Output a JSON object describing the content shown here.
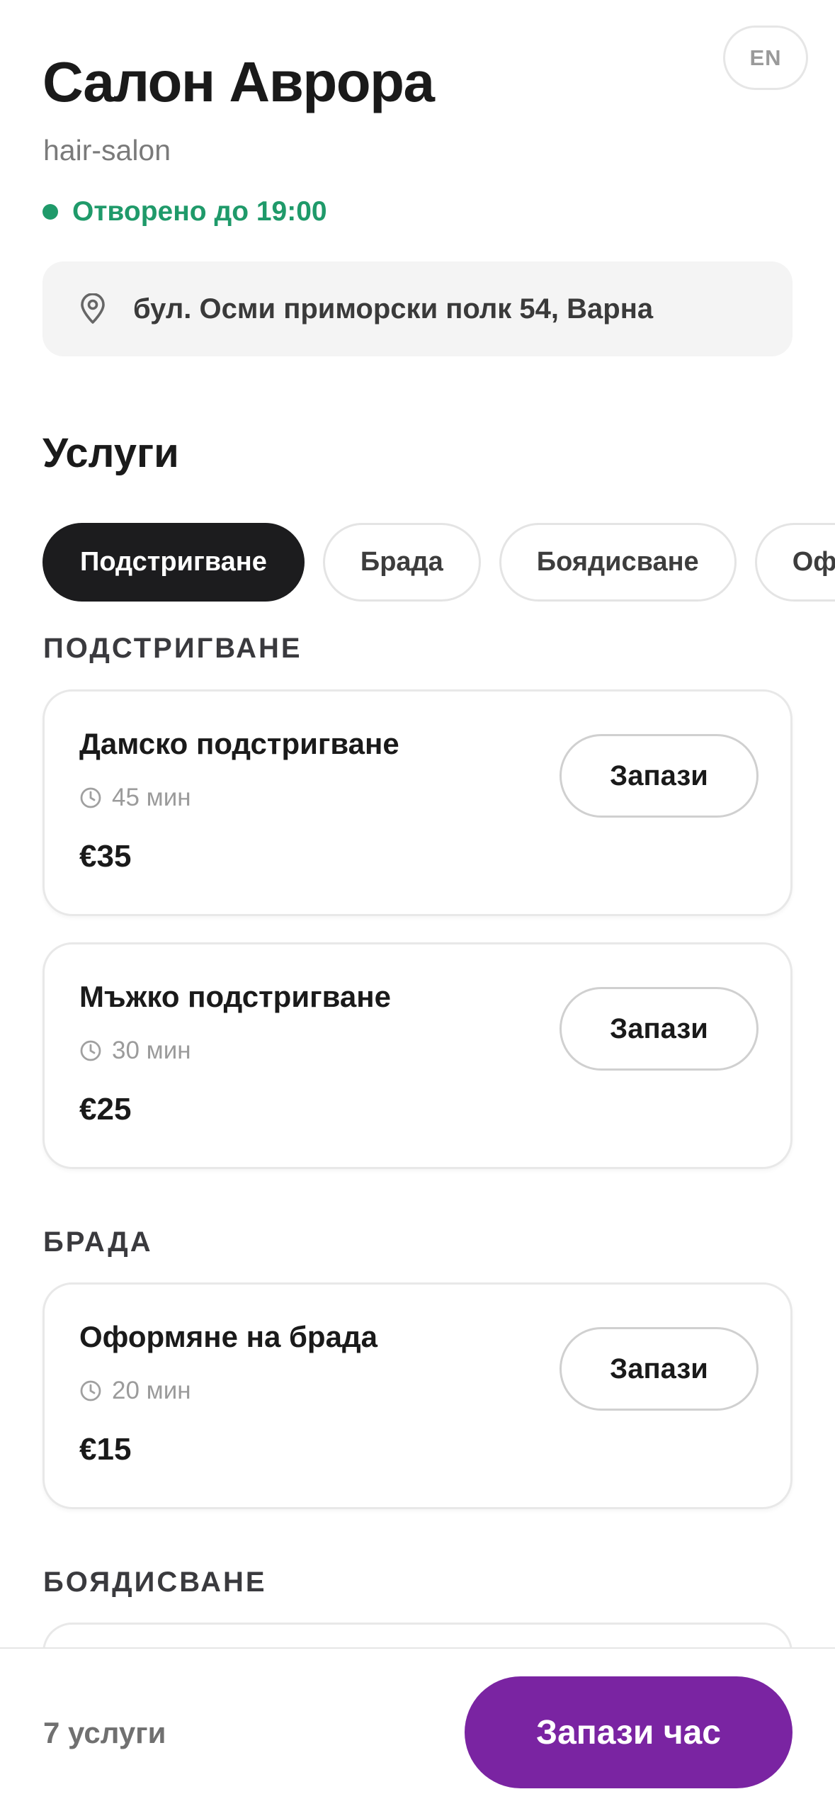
{
  "header": {
    "title": "Салон Аврора",
    "category": "hair-salon",
    "lang_button": "EN",
    "status_text": "Отворено до 19:00",
    "status_color": "#1f9a6a",
    "address": "бул. Осми приморски полк 54, Варна",
    "address_icon": "location-pin-icon"
  },
  "services": {
    "section_title": "Услуги",
    "tabs": [
      {
        "label": "Подстригване",
        "active": true
      },
      {
        "label": "Брада",
        "active": false
      },
      {
        "label": "Боядисване",
        "active": false
      },
      {
        "label": "Оформяне",
        "active": false
      }
    ],
    "groups": [
      {
        "label": "ПОДСТРИГВАНЕ",
        "items": [
          {
            "name": "Дамско подстригване",
            "duration": "45 мин",
            "price": "€35",
            "button": "Запази"
          },
          {
            "name": "Мъжко подстригване",
            "duration": "30 мин",
            "price": "€25",
            "button": "Запази"
          }
        ]
      },
      {
        "label": "БРАДА",
        "items": [
          {
            "name": "Оформяне на брада",
            "duration": "20 мин",
            "price": "€15",
            "button": "Запази"
          }
        ]
      },
      {
        "label": "БОЯДИСВАНЕ",
        "items": []
      }
    ]
  },
  "bottom_bar": {
    "count_text": "7 услуги",
    "cta_label": "Запази час",
    "cta_color": "#7a24a2"
  }
}
